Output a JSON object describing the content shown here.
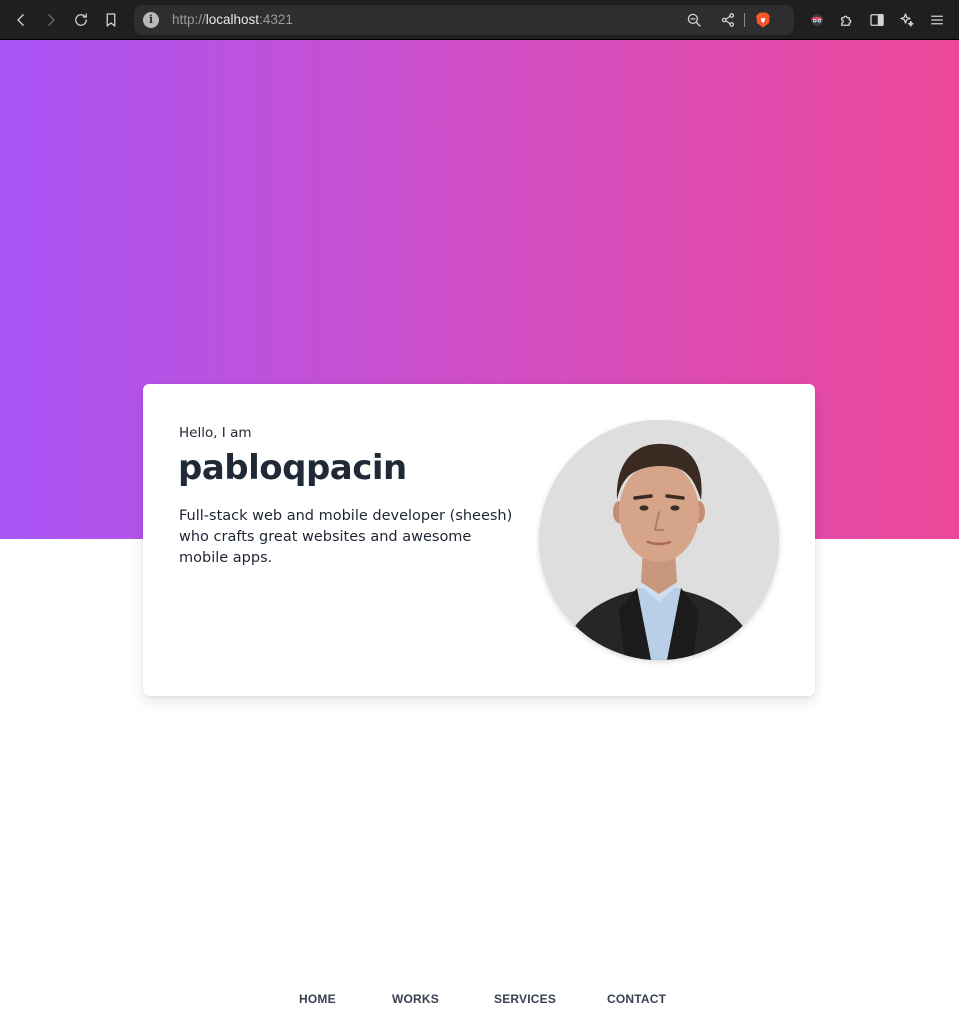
{
  "browser": {
    "url_scheme": "http://",
    "url_host": "localhost",
    "url_port": ":4321"
  },
  "hero": {
    "gradient_start": "#a855f7",
    "gradient_end": "#ec4899"
  },
  "intro": {
    "greeting": "Hello, I am",
    "name": "pabloqpacin",
    "bio": "Full-stack web and mobile developer (sheesh) who crafts great websites and awesome mobile apps."
  },
  "nav": {
    "items": [
      "HOME",
      "WORKS",
      "SERVICES",
      "CONTACT"
    ]
  }
}
